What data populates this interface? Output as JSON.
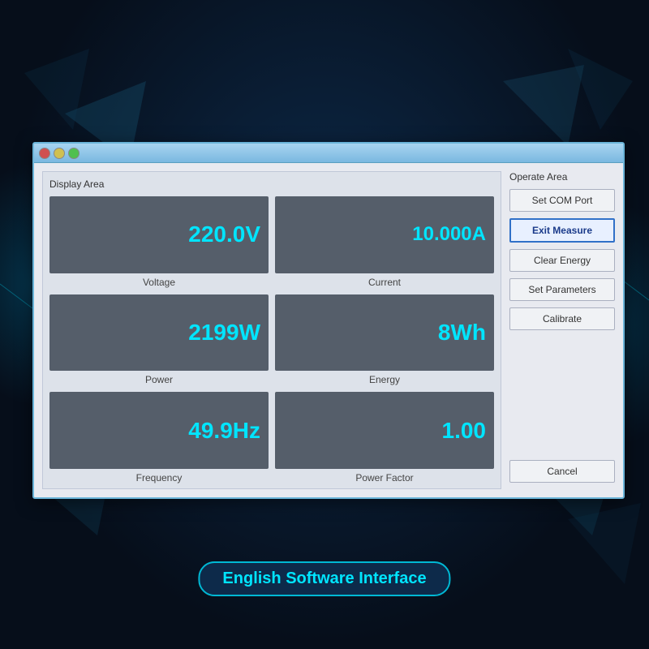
{
  "background": {
    "color": "#0a1a2e"
  },
  "window": {
    "display_area_label": "Display Area",
    "operate_area_label": "Operate Area"
  },
  "gauges": [
    {
      "id": "voltage",
      "value": "220.0V",
      "label": "Voltage",
      "col": 1,
      "row": 1
    },
    {
      "id": "current",
      "value": "10.000A",
      "label": "Current",
      "col": 2,
      "row": 1
    },
    {
      "id": "power",
      "value": "2199W",
      "label": "Power",
      "col": 1,
      "row": 2
    },
    {
      "id": "energy",
      "value": "8Wh",
      "label": "Energy",
      "col": 2,
      "row": 2
    },
    {
      "id": "frequency",
      "value": "49.9Hz",
      "label": "Frequency",
      "col": 1,
      "row": 3
    },
    {
      "id": "power_factor",
      "value": "1.00",
      "label": "Power Factor",
      "col": 2,
      "row": 3
    }
  ],
  "buttons": [
    {
      "id": "set-com-port",
      "label": "Set COM Port",
      "active": false
    },
    {
      "id": "exit-measure",
      "label": "Exit Measure",
      "active": true
    },
    {
      "id": "clear-energy",
      "label": "Clear Energy",
      "active": false
    },
    {
      "id": "set-parameters",
      "label": "Set Parameters",
      "active": false
    },
    {
      "id": "calibrate",
      "label": "Calibrate",
      "active": false
    },
    {
      "id": "cancel",
      "label": "Cancel",
      "active": false
    }
  ],
  "footer_label": "English Software Interface"
}
